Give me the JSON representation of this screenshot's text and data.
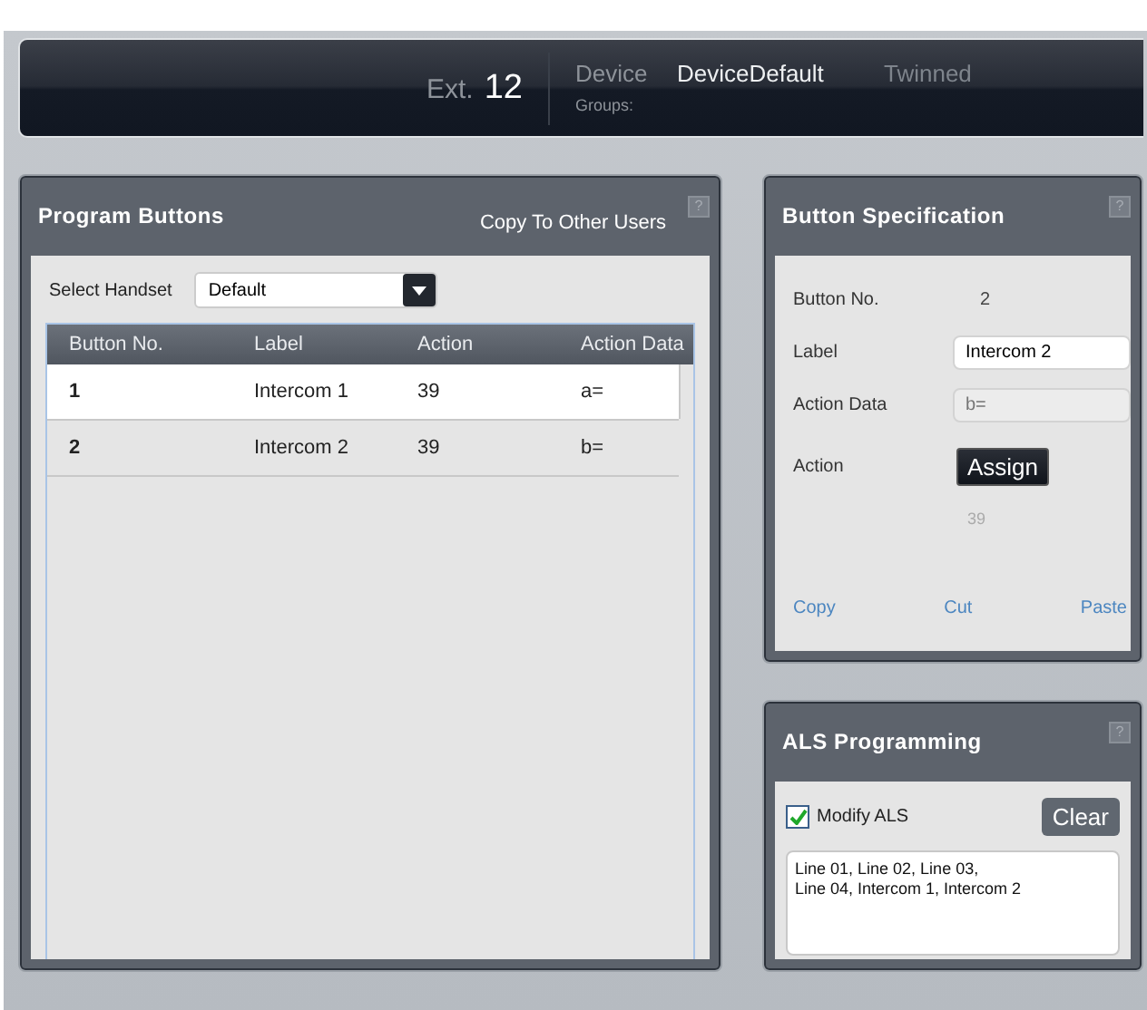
{
  "header": {
    "ext_label": "Ext.",
    "ext_number": "12",
    "device_label": "Device",
    "device_value": "DeviceDefault",
    "twinned_label": "Twinned",
    "groups_label": "Groups:"
  },
  "program_buttons": {
    "title": "Program Buttons",
    "copy_link": "Copy To Other Users",
    "help": "?",
    "handset_label": "Select Handset",
    "handset_value": "Default",
    "table": {
      "columns": [
        "Button No.",
        "Label",
        "Action",
        "Action Data"
      ],
      "rows": [
        {
          "cells": [
            "1",
            "Intercom 1",
            "39",
            "a="
          ],
          "selected": true
        },
        {
          "cells": [
            "2",
            "Intercom 2",
            "39",
            "b="
          ],
          "selected": false
        }
      ]
    }
  },
  "button_specification": {
    "title": "Button Specification",
    "help": "?",
    "button_no_label": "Button No.",
    "button_no_value": "2",
    "label_label": "Label",
    "label_value": "Intercom 2",
    "action_data_label": "Action Data",
    "action_data_placeholder": "b=",
    "action_label": "Action",
    "assign_button": "Assign",
    "action_value": "39",
    "links": [
      "Copy",
      "Cut",
      "Paste"
    ]
  },
  "als_programming": {
    "title": "ALS Programming",
    "help": "?",
    "modify_label": "Modify ALS",
    "modify_checked": true,
    "clear_button": "Clear",
    "lines": [
      "Line 01, Line 02, Line 03,",
      "Line 04, Intercom 1, Intercom 2"
    ]
  }
}
